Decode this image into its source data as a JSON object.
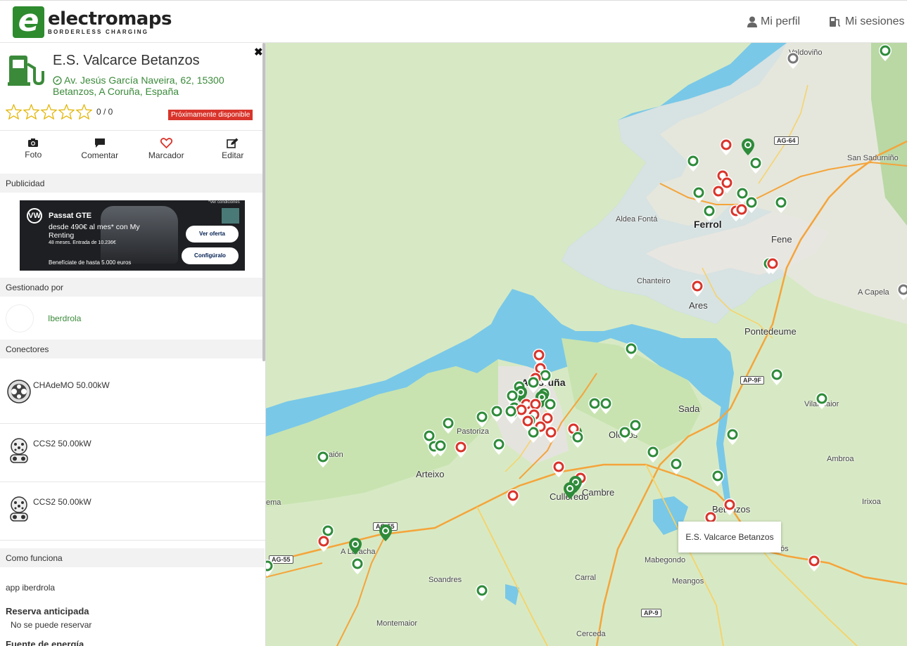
{
  "header": {
    "logo_name": "electromaps",
    "logo_sub": "BORDERLESS CHARGING",
    "profile_label": "Mi perfil",
    "sessions_label": "Mi sesiones"
  },
  "station": {
    "name": "E.S. Valcarce Betanzos",
    "address": "Av. Jesús García Naveira, 62, 15300 Betanzos, A Coruña, España",
    "rating_text": "0 / 0",
    "rating_value": 0,
    "rating_max": 5,
    "status_badge": "Próximamente disponible",
    "status_color": "#d9342b"
  },
  "actions": [
    {
      "label": "Foto",
      "icon": "camera-icon"
    },
    {
      "label": "Comentar",
      "icon": "comment-icon"
    },
    {
      "label": "Marcador",
      "icon": "heart-icon"
    },
    {
      "label": "Editar",
      "icon": "edit-icon"
    }
  ],
  "sections": {
    "advertising": "Publicidad",
    "managed_by": "Gestionado por",
    "connectors": "Conectores",
    "how_it_works": "Como funciona"
  },
  "ad": {
    "brand": "VW",
    "title": "Passat GTE",
    "price": "desde 490€ al mes* con My Renting",
    "small": "48 meses. Entrada de 10.236€",
    "benefit": "Benefíciate de hasta 5.000 euros",
    "btn_offer": "Ver oferta",
    "btn_config": "Configúralo",
    "conditions": "*Ver condiciones"
  },
  "operator": {
    "name": "Iberdrola"
  },
  "connectors": [
    {
      "label": "CHAdeMO 50.00kW",
      "icon": "chademo-icon"
    },
    {
      "label": "CCS2 50.00kW",
      "icon": "ccs2-icon"
    },
    {
      "label": "CCS2 50.00kW",
      "icon": "ccs2-icon"
    }
  ],
  "how_it_works": {
    "app": "app iberdrola",
    "reservation_title": "Reserva anticipada",
    "reservation_value": "No se puede reservar",
    "energy_title": "Fuente de energía"
  },
  "map": {
    "tooltip": "E.S. Valcarce Betanzos",
    "places": [
      {
        "name": "Valdoviño",
        "cls": "place"
      },
      {
        "name": "San Sadurniño",
        "cls": "place"
      },
      {
        "name": "Aldea Fontá",
        "cls": "place"
      },
      {
        "name": "Ferrol",
        "cls": "city"
      },
      {
        "name": "Fene",
        "cls": "town"
      },
      {
        "name": "Chanteiro",
        "cls": "place"
      },
      {
        "name": "Ares",
        "cls": "town"
      },
      {
        "name": "A Capela",
        "cls": "place"
      },
      {
        "name": "Pontedeume",
        "cls": "town"
      },
      {
        "name": "A Coruña",
        "cls": "city"
      },
      {
        "name": "Sada",
        "cls": "town"
      },
      {
        "name": "Vilarmaior",
        "cls": "place"
      },
      {
        "name": "Pastoriza",
        "cls": "place"
      },
      {
        "name": "Oleiros",
        "cls": "town"
      },
      {
        "name": "Ambroa",
        "cls": "place"
      },
      {
        "name": "Arteixo",
        "cls": "town"
      },
      {
        "name": "Culleredo",
        "cls": "town"
      },
      {
        "name": "Cambre",
        "cls": "town"
      },
      {
        "name": "Betanzos",
        "cls": "town"
      },
      {
        "name": "Irixoa",
        "cls": "place"
      },
      {
        "name": "A Laracha",
        "cls": "place"
      },
      {
        "name": "Mabegondo",
        "cls": "place"
      },
      {
        "name": "Soandres",
        "cls": "place"
      },
      {
        "name": "Carral",
        "cls": "place"
      },
      {
        "name": "Meangos",
        "cls": "place"
      },
      {
        "name": "Montemaior",
        "cls": "place"
      },
      {
        "name": "Cerceda",
        "cls": "place"
      },
      {
        "name": "aión",
        "cls": "place"
      },
      {
        "name": "ema",
        "cls": "place"
      },
      {
        "name": "ós",
        "cls": "place"
      }
    ],
    "roads": [
      "AG-64",
      "AP-9F",
      "AG-55",
      "AG-55",
      "AP-9"
    ]
  }
}
